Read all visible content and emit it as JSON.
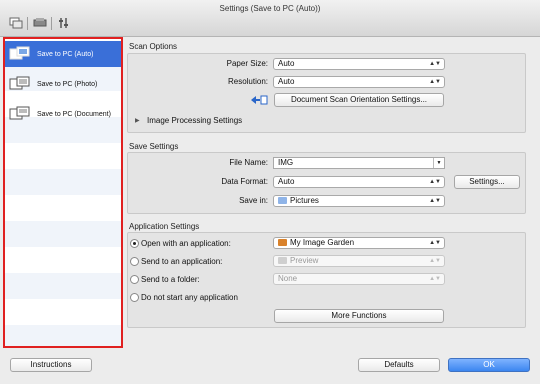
{
  "window": {
    "title": "Settings (Save to PC (Auto))"
  },
  "toolbar": {
    "icons": [
      "scan-from-computer-icon",
      "scanner-icon",
      "general-settings-icon"
    ]
  },
  "sidebar": {
    "items": [
      {
        "label": "Save to PC (Auto)",
        "icon": "save-pc-auto-icon",
        "selected": true
      },
      {
        "label": "Save to PC (Photo)",
        "icon": "save-pc-photo-icon",
        "selected": false
      },
      {
        "label": "Save to PC (Document)",
        "icon": "save-pc-document-icon",
        "selected": false
      }
    ]
  },
  "scan_options": {
    "title": "Scan Options",
    "paper_size_label": "Paper Size:",
    "paper_size_value": "Auto",
    "resolution_label": "Resolution:",
    "resolution_value": "Auto",
    "orientation_button": "Document Scan Orientation Settings...",
    "image_processing_label": "Image Processing Settings"
  },
  "save_settings": {
    "title": "Save Settings",
    "file_name_label": "File Name:",
    "file_name_value": "IMG",
    "data_format_label": "Data Format:",
    "data_format_value": "Auto",
    "settings_button": "Settings...",
    "save_in_label": "Save in:",
    "save_in_value": "Pictures"
  },
  "application_settings": {
    "title": "Application Settings",
    "open_with_label": "Open with an application:",
    "open_with_value": "My Image Garden",
    "send_app_label": "Send to an application:",
    "send_app_value": "Preview",
    "send_folder_label": "Send to a folder:",
    "send_folder_value": "None",
    "do_not_start_label": "Do not start any application",
    "more_functions_button": "More Functions",
    "selected": "open_with"
  },
  "footer": {
    "instructions_button": "Instructions",
    "defaults_button": "Defaults",
    "ok_button": "OK"
  },
  "colors": {
    "selection": "#3a6fd8",
    "highlight_border": "#e02020",
    "ok_button": "#3c86f0"
  }
}
